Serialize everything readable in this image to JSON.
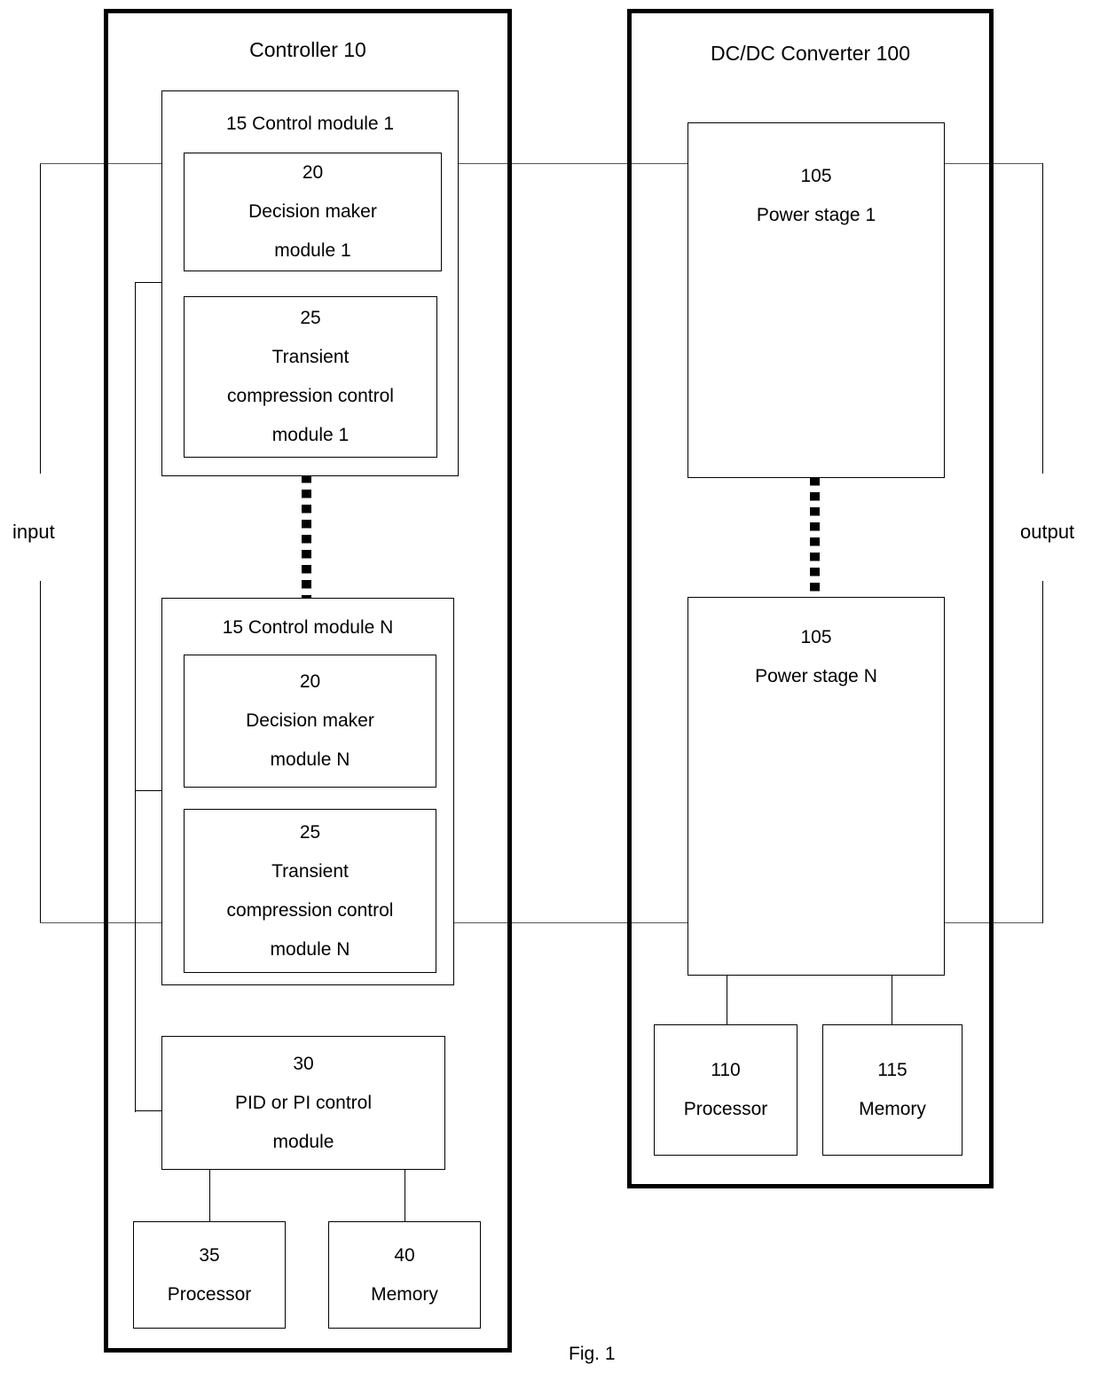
{
  "figure": {
    "caption": "Fig. 1"
  },
  "labels": {
    "input": "input",
    "output": "output"
  },
  "controller": {
    "title": "Controller 10",
    "control_module_1": {
      "title": "15 Control module 1",
      "decision_maker": {
        "ref": "20",
        "line1": "Decision maker",
        "line2": "module 1"
      },
      "transient": {
        "ref": "25",
        "line1": "Transient",
        "line2": "compression control",
        "line3": "module 1"
      }
    },
    "control_module_n": {
      "title": "15 Control module N",
      "decision_maker": {
        "ref": "20",
        "line1": "Decision maker",
        "line2": "module N"
      },
      "transient": {
        "ref": "25",
        "line1": "Transient",
        "line2": "compression control",
        "line3": "module N"
      }
    },
    "pid_module": {
      "ref": "30",
      "line1": "PID or PI control",
      "line2": "module"
    },
    "processor": {
      "ref": "35",
      "name": "Processor"
    },
    "memory": {
      "ref": "40",
      "name": "Memory"
    }
  },
  "converter": {
    "title": "DC/DC Converter 100",
    "power_stage_1": {
      "ref": "105",
      "name": "Power stage 1"
    },
    "power_stage_n": {
      "ref": "105",
      "name": "Power stage N"
    },
    "processor": {
      "ref": "110",
      "name": "Processor"
    },
    "memory": {
      "ref": "115",
      "name": "Memory"
    }
  },
  "colors": {
    "line": "#555555",
    "border": "#000000",
    "background": "#ffffff"
  }
}
